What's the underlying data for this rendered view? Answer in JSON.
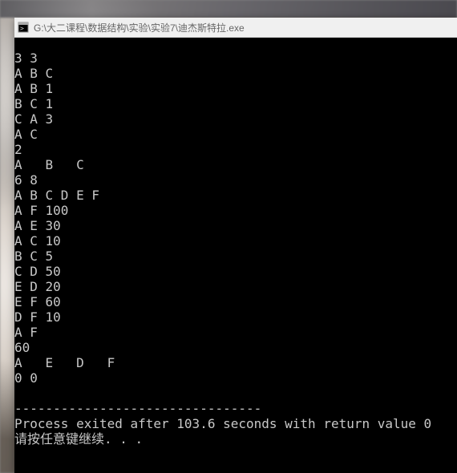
{
  "window": {
    "title": "G:\\大二课程\\数据结构\\实验\\实验7\\迪杰斯特拉.exe",
    "icon_name": "console-app-icon"
  },
  "console": {
    "lines": [
      "3 3",
      "A B C",
      "A B 1",
      "B C 1",
      "C A 3",
      "A C",
      "2",
      "A   B   C",
      "6 8",
      "A B C D E F",
      "A F 100",
      "A E 30",
      "A C 10",
      "B C 5",
      "C D 50",
      "E D 20",
      "E F 60",
      "D F 10",
      "A F",
      "60",
      "A   E   D   F",
      "0 0",
      "",
      "--------------------------------",
      "Process exited after 103.6 seconds with return value 0",
      "请按任意键继续. . ."
    ]
  }
}
